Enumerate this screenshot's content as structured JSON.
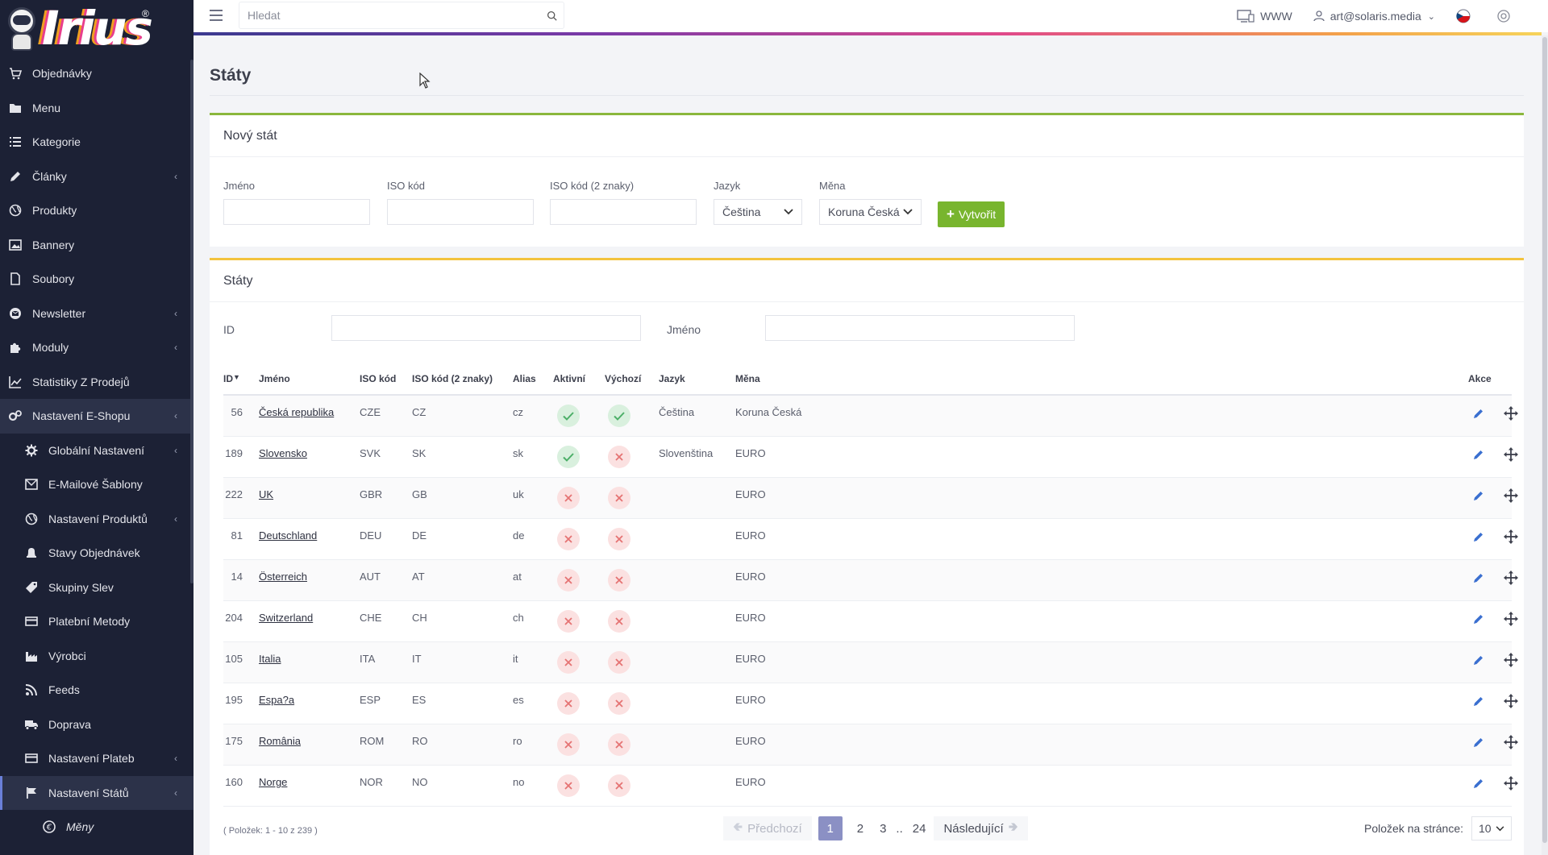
{
  "brand": {
    "logo_text": "Irius",
    "logo_mark": "®"
  },
  "sidebar": {
    "items": [
      {
        "label": "Objednávky",
        "icon": "cart-icon",
        "chevron": false
      },
      {
        "label": "Menu",
        "icon": "folder-icon",
        "chevron": false
      },
      {
        "label": "Kategorie",
        "icon": "list-icon",
        "chevron": false
      },
      {
        "label": "Články",
        "icon": "pencil-icon",
        "chevron": true
      },
      {
        "label": "Produkty",
        "icon": "globe-icon",
        "chevron": false
      },
      {
        "label": "Bannery",
        "icon": "image-icon",
        "chevron": false
      },
      {
        "label": "Soubory",
        "icon": "file-icon",
        "chevron": false
      },
      {
        "label": "Newsletter",
        "icon": "mail-circle-icon",
        "chevron": true
      },
      {
        "label": "Moduly",
        "icon": "puzzle-icon",
        "chevron": true
      },
      {
        "label": "Statistiky Z Prodejů",
        "icon": "chart-icon",
        "chevron": false
      },
      {
        "label": "Nastavení E-Shopu",
        "icon": "cogs-icon",
        "chevron": true,
        "active": true
      }
    ],
    "subitems": [
      {
        "label": "Globální Nastavení",
        "icon": "gear-icon",
        "chevron": true
      },
      {
        "label": "E-Mailové Šablony",
        "icon": "envelope-icon",
        "chevron": false
      },
      {
        "label": "Nastavení Produktů",
        "icon": "globe-icon",
        "chevron": true
      },
      {
        "label": "Stavy Objednávek",
        "icon": "bell-icon",
        "chevron": false
      },
      {
        "label": "Skupiny Slev",
        "icon": "tag-icon",
        "chevron": false
      },
      {
        "label": "Platební Metody",
        "icon": "card-icon",
        "chevron": false
      },
      {
        "label": "Výrobci",
        "icon": "factory-icon",
        "chevron": false
      },
      {
        "label": "Feeds",
        "icon": "rss-icon",
        "chevron": false
      },
      {
        "label": "Doprava",
        "icon": "truck-icon",
        "chevron": false
      },
      {
        "label": "Nastavení Plateb",
        "icon": "card-icon",
        "chevron": true
      },
      {
        "label": "Nastavení Států",
        "icon": "flag-icon",
        "chevron": true,
        "active": true
      }
    ],
    "subsubitems": [
      {
        "label": "Měny",
        "icon": "euro-icon"
      }
    ]
  },
  "topbar": {
    "search_placeholder": "Hledat",
    "www_label": "WWW",
    "user_email": "art@solaris.media"
  },
  "page": {
    "title": "Státy"
  },
  "new_state": {
    "title": "Nový stát",
    "fields": {
      "name_label": "Jméno",
      "iso_label": "ISO kód",
      "iso2_label": "ISO kód (2 znaky)",
      "language_label": "Jazyk",
      "language_value": "Čeština",
      "currency_label": "Měna",
      "currency_value": "Koruna Česká"
    },
    "create_label": "Vytvořit"
  },
  "states": {
    "title": "Státy",
    "filter": {
      "id_label": "ID",
      "name_label": "Jméno"
    },
    "columns": {
      "id": "ID",
      "name": "Jméno",
      "iso": "ISO kód",
      "iso2": "ISO kód (2 znaky)",
      "alias": "Alias",
      "active": "Aktivní",
      "default": "Výchozí",
      "language": "Jazyk",
      "currency": "Měna",
      "actions": "Akce"
    },
    "rows": [
      {
        "id": "56",
        "name": "Česká republika",
        "iso": "CZE",
        "iso2": "CZ",
        "alias": "cz",
        "active": true,
        "default": true,
        "language": "Čeština",
        "currency": "Koruna Česká"
      },
      {
        "id": "189",
        "name": "Slovensko",
        "iso": "SVK",
        "iso2": "SK",
        "alias": "sk",
        "active": true,
        "default": false,
        "language": "Slovenština",
        "currency": "EURO"
      },
      {
        "id": "222",
        "name": "UK",
        "iso": "GBR",
        "iso2": "GB",
        "alias": "uk",
        "active": false,
        "default": false,
        "language": "",
        "currency": "EURO"
      },
      {
        "id": "81",
        "name": "Deutschland",
        "iso": "DEU",
        "iso2": "DE",
        "alias": "de",
        "active": false,
        "default": false,
        "language": "",
        "currency": "EURO"
      },
      {
        "id": "14",
        "name": "Österreich",
        "iso": "AUT",
        "iso2": "AT",
        "alias": "at",
        "active": false,
        "default": false,
        "language": "",
        "currency": "EURO"
      },
      {
        "id": "204",
        "name": "Switzerland",
        "iso": "CHE",
        "iso2": "CH",
        "alias": "ch",
        "active": false,
        "default": false,
        "language": "",
        "currency": "EURO"
      },
      {
        "id": "105",
        "name": "Italia",
        "iso": "ITA",
        "iso2": "IT",
        "alias": "it",
        "active": false,
        "default": false,
        "language": "",
        "currency": "EURO"
      },
      {
        "id": "195",
        "name": "Espa?a",
        "iso": "ESP",
        "iso2": "ES",
        "alias": "es",
        "active": false,
        "default": false,
        "language": "",
        "currency": "EURO"
      },
      {
        "id": "175",
        "name": "România",
        "iso": "ROM",
        "iso2": "RO",
        "alias": "ro",
        "active": false,
        "default": false,
        "language": "",
        "currency": "EURO"
      },
      {
        "id": "160",
        "name": "Norge",
        "iso": "NOR",
        "iso2": "NO",
        "alias": "no",
        "active": false,
        "default": false,
        "language": "",
        "currency": "EURO"
      }
    ],
    "count_info": "( Položek: 1 - 10 z 239 )",
    "pagination": {
      "prev_label": "Předchozí",
      "pages": [
        "1",
        "2",
        "3"
      ],
      "ellipsis": "..",
      "last_page": "24",
      "next_label": "Následující",
      "current": "1"
    },
    "per_page_label": "Položek na stránce:",
    "per_page_value": "10"
  },
  "colors": {
    "sidebar_bg": "#1c2135",
    "create_green": "#78b52e",
    "card_green": "#8ab73c",
    "card_yellow": "#f3c33e",
    "ok_bg": "#d9f0de",
    "no_bg": "#fbe1e1",
    "pagination_current": "#8b90c4"
  }
}
